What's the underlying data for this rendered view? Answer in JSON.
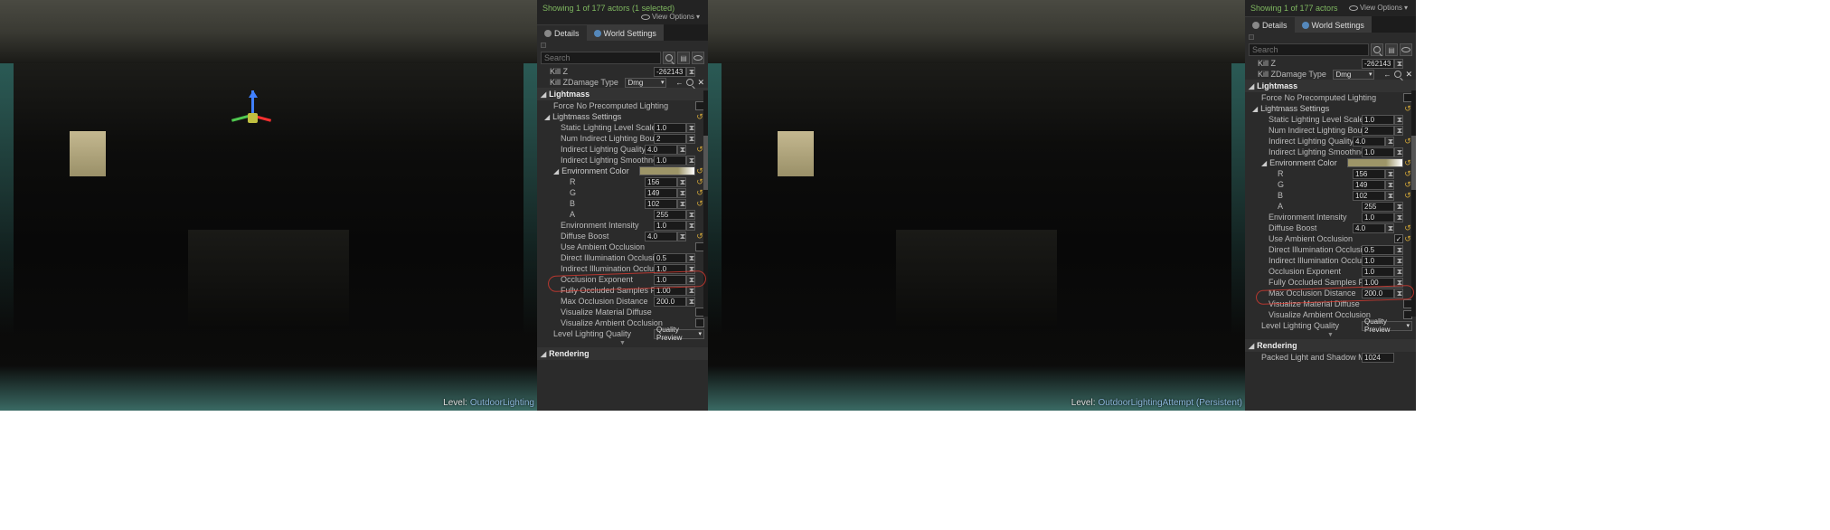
{
  "status": {
    "left": "Showing 1 of 177 actors (1 selected)",
    "right": "Showing 1 of 177 actors"
  },
  "view_options": "View Options",
  "tabs": {
    "details": "Details",
    "world_settings": "World Settings"
  },
  "search_placeholder": "Search",
  "kill_z": {
    "label": "Kill Z",
    "value": "-262143.0"
  },
  "kill_z_damage": {
    "label": "Kill ZDamage Type",
    "value": "Dmg"
  },
  "lightmass": {
    "title": "Lightmass",
    "force_no_precomputed": "Force No Precomputed Lighting",
    "settings": "Lightmass Settings",
    "static_scale": {
      "label": "Static Lighting Level Scale",
      "value": "1.0"
    },
    "bounces": {
      "label": "Num Indirect Lighting Bounces",
      "value": "2"
    },
    "quality": {
      "label": "Indirect Lighting Quality",
      "value": "4.0"
    },
    "smoothness": {
      "label": "Indirect Lighting Smoothness",
      "value": "1.0"
    },
    "env_color": "Environment Color",
    "r": {
      "label": "R",
      "value": "156"
    },
    "g": {
      "label": "G",
      "value": "149"
    },
    "b": {
      "label": "B",
      "value": "102"
    },
    "a": {
      "label": "A",
      "value": "255"
    },
    "env_intensity": {
      "label": "Environment Intensity",
      "value": "1.0"
    },
    "diffuse_boost": {
      "label": "Diffuse Boost",
      "value": "4.0"
    },
    "use_ao": "Use Ambient Occlusion",
    "direct_ao": {
      "label": "Direct Illumination Occlusion Frac",
      "value": "0.5"
    },
    "indirect_ao": {
      "label": "Indirect Illumination Occlusion Fr",
      "value": "1.0"
    },
    "ao_exp": {
      "label": "Occlusion Exponent",
      "value": "1.0"
    },
    "fully_occ": {
      "label": "Fully Occluded Samples Fraction",
      "value": "1.00"
    },
    "max_ao": {
      "label": "Max Occlusion Distance",
      "value": "200.0"
    },
    "vis_diffuse": "Visualize Material Diffuse",
    "vis_ao": "Visualize Ambient Occlusion",
    "level_quality": {
      "label": "Level Lighting Quality",
      "value": "Quality Preview"
    },
    "packed": {
      "label": "Packed Light and Shadow Map Text",
      "value": "1024"
    }
  },
  "rendering": "Rendering",
  "level_hint": {
    "label": "Level:",
    "left": "OutdoorLighting",
    "right": "OutdoorLightingAttempt (Persistent)"
  }
}
